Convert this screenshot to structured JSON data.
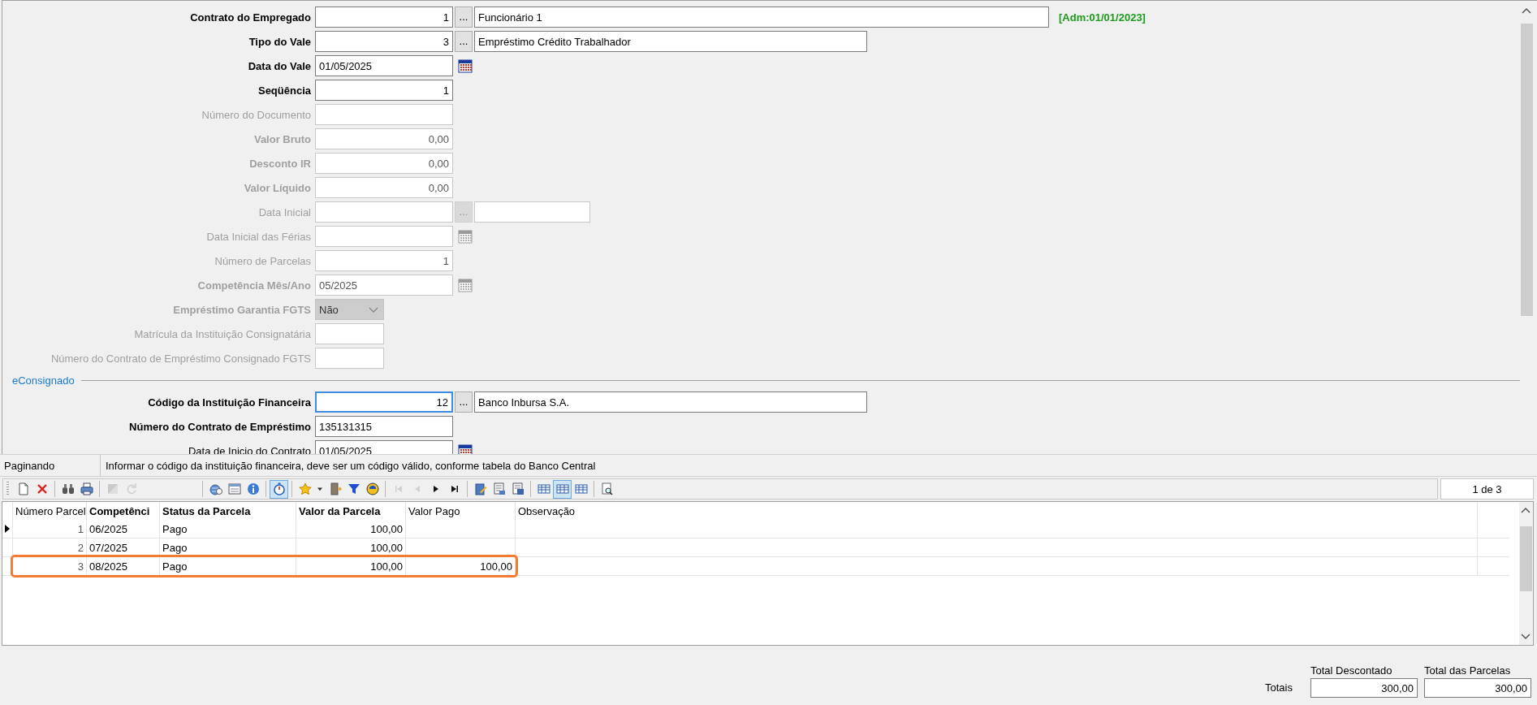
{
  "form": {
    "fields": [
      {
        "label": "Contrato do Empregado",
        "bold": true,
        "disabled": false,
        "kind": "lookup",
        "value": "1",
        "button": "...",
        "description": "Funcionário 1",
        "note": "[Adm:01/01/2023]"
      },
      {
        "label": "Tipo do Vale",
        "bold": true,
        "disabled": false,
        "kind": "lookup",
        "value": "3",
        "button": "...",
        "description": "Empréstimo Crédito Trabalhador"
      },
      {
        "label": "Data do Vale",
        "bold": true,
        "disabled": false,
        "kind": "date",
        "value": "01/05/2025"
      },
      {
        "label": "Seqüência",
        "bold": true,
        "disabled": false,
        "kind": "number",
        "value": "1"
      },
      {
        "label": "Número do Documento",
        "bold": false,
        "disabled": true,
        "kind": "text"
      },
      {
        "label": "Valor Bruto",
        "bold": true,
        "disabled": true,
        "kind": "number",
        "value": "0,00"
      },
      {
        "label": "Desconto IR",
        "bold": true,
        "disabled": true,
        "kind": "number",
        "value": "0,00"
      },
      {
        "label": "Valor Líquido",
        "bold": true,
        "disabled": true,
        "kind": "number",
        "value": "0,00"
      },
      {
        "label": "Data Inicial",
        "bold": false,
        "disabled": true,
        "kind": "lookup",
        "button": "..."
      },
      {
        "label": "Data Inicial das Férias",
        "bold": false,
        "disabled": true,
        "kind": "date"
      },
      {
        "label": "Número de Parcelas",
        "bold": false,
        "disabled": true,
        "kind": "number",
        "value": "1"
      },
      {
        "label": "Competência Mês/Ano",
        "bold": true,
        "disabled": true,
        "kind": "date",
        "value": "05/2025"
      },
      {
        "label": "Empréstimo Garantia FGTS",
        "bold": true,
        "disabled": true,
        "kind": "select",
        "value": "Não"
      },
      {
        "label": "Matrícula da Instituição Consignatária",
        "bold": false,
        "disabled": true,
        "kind": "short"
      },
      {
        "label": "Número do Contrato de Empréstimo Consignado FGTS",
        "bold": false,
        "disabled": true,
        "kind": "short"
      },
      {
        "kind": "section",
        "label": "eConsignado"
      },
      {
        "label": "Código da Instituição Financeira",
        "bold": true,
        "disabled": false,
        "focused": true,
        "kind": "lookup",
        "value": "12",
        "button": "...",
        "description": "Banco Inbursa S.A."
      },
      {
        "label": "Número do Contrato de Empréstimo",
        "bold": true,
        "disabled": false,
        "kind": "text",
        "value": "135131315"
      },
      {
        "label": "Data de Inicio do Contrato",
        "bold": false,
        "disabled": false,
        "kind": "date",
        "value": "01/05/2025"
      }
    ]
  },
  "status_bar": {
    "mode": "Paginando",
    "hint": "Informar o código da instituição financeira, deve ser um código válido, conforme tabela do Banco Central"
  },
  "toolbar": {
    "buttons": [
      {
        "kind": "new",
        "pressed": false,
        "disabled": false
      },
      {
        "kind": "delete",
        "pressed": false,
        "disabled": false
      },
      {
        "kind": "separator"
      },
      {
        "kind": "find",
        "pressed": false,
        "disabled": false
      },
      {
        "kind": "print",
        "pressed": false,
        "disabled": false
      },
      {
        "kind": "separator"
      },
      {
        "kind": "save",
        "pressed": false,
        "disabled": true
      },
      {
        "kind": "refresh",
        "pressed": false,
        "disabled": true
      },
      {
        "kind": "spacer"
      },
      {
        "kind": "separator"
      },
      {
        "kind": "help",
        "pressed": false,
        "disabled": false
      },
      {
        "kind": "form",
        "pressed": false,
        "disabled": false
      },
      {
        "kind": "info",
        "pressed": false,
        "disabled": false
      },
      {
        "kind": "separator"
      },
      {
        "kind": "timer",
        "pressed": true,
        "disabled": false
      },
      {
        "kind": "separator"
      },
      {
        "kind": "star",
        "pressed": false,
        "disabled": false
      },
      {
        "kind": "caret",
        "pressed": false,
        "disabled": false
      },
      {
        "kind": "exit",
        "pressed": false,
        "disabled": false
      },
      {
        "kind": "filter",
        "pressed": false,
        "disabled": false
      },
      {
        "kind": "globe",
        "pressed": false,
        "disabled": false
      },
      {
        "kind": "separator"
      },
      {
        "kind": "first",
        "pressed": false,
        "disabled": true
      },
      {
        "kind": "prev",
        "pressed": false,
        "disabled": true
      },
      {
        "kind": "next",
        "pressed": false,
        "disabled": false
      },
      {
        "kind": "last",
        "pressed": false,
        "disabled": false
      },
      {
        "kind": "separator"
      },
      {
        "kind": "edit",
        "pressed": false,
        "disabled": false
      },
      {
        "kind": "report",
        "pressed": false,
        "disabled": false
      },
      {
        "kind": "export",
        "pressed": false,
        "disabled": false
      },
      {
        "kind": "separator"
      },
      {
        "kind": "grid",
        "pressed": false,
        "disabled": false
      },
      {
        "kind": "grid",
        "pressed": true,
        "disabled": false
      },
      {
        "kind": "grid",
        "pressed": false,
        "disabled": false
      },
      {
        "kind": "separator"
      },
      {
        "kind": "preview",
        "pressed": false,
        "disabled": false
      }
    ],
    "page": "1 de 3"
  },
  "grid": {
    "columns": [
      {
        "label": "Número Parcel",
        "bold": false
      },
      {
        "label": "Competênci",
        "bold": true
      },
      {
        "label": "Status da Parcela",
        "bold": true
      },
      {
        "label": "Valor da Parcela",
        "bold": true
      },
      {
        "label": "Valor Pago",
        "bold": false
      },
      {
        "label": "Observação",
        "bold": false
      }
    ],
    "rows": [
      {
        "cells": [
          "1",
          "06/2025",
          "Pago",
          "100,00",
          null,
          null
        ],
        "current": true,
        "highlighted": false
      },
      {
        "cells": [
          "2",
          "07/2025",
          "Pago",
          "100,00",
          null,
          null
        ],
        "current": false,
        "highlighted": false
      },
      {
        "cells": [
          "3",
          "08/2025",
          "Pago",
          "100,00",
          "100,00",
          null
        ],
        "current": false,
        "highlighted": true
      }
    ]
  },
  "totals": {
    "label": "Totais",
    "items": [
      {
        "label": "Total Descontado",
        "value": "300,00"
      },
      {
        "label": "Total das Parcelas",
        "value": "300,00"
      }
    ]
  }
}
